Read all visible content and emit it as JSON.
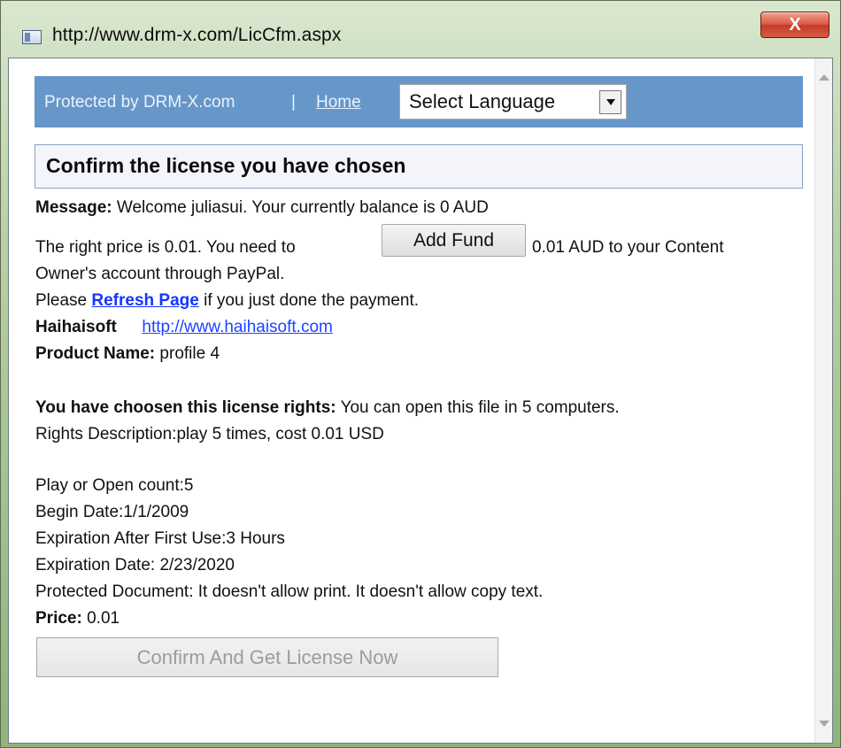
{
  "window": {
    "title": "http://www.drm-x.com/LicCfm.aspx",
    "close_label": "X"
  },
  "header": {
    "protected_by": "Protected by DRM-X.com",
    "separator": "|",
    "home_label": "Home",
    "language_select_value": "Select Language"
  },
  "section": {
    "title": "Confirm the license you have chosen"
  },
  "content": {
    "message_label": "Message:",
    "message_text": "Welcome juliasui. Your currently balance is 0 AUD",
    "price_line_prefix": "The right price is 0.01. You need to",
    "add_fund_label": "Add Fund",
    "price_line_suffix": "0.01 AUD to your Content",
    "owner_line": "Owner's account through PayPal.",
    "refresh_prefix": "Please",
    "refresh_link": "Refresh Page",
    "refresh_suffix": "if you just done the payment.",
    "company_name": "Haihaisoft",
    "company_link": "http://www.haihaisoft.com",
    "product_label": "Product Name:",
    "product_value": "profile 4",
    "rights_label": "You have choosen this license rights:",
    "rights_value": "You can open this file in 5 computers.",
    "rights_description": "Rights Description:play 5 times, cost 0.01 USD",
    "play_count": "Play or Open count:5",
    "begin_date": "Begin Date:1/1/2009",
    "expiration_after_first_use": "Expiration After First Use:3 Hours",
    "expiration_date": "Expiration Date: 2/23/2020",
    "protected_document": "Protected Document: It doesn't allow print. It doesn't allow copy text.",
    "price_label": "Price:",
    "price_value": "0.01",
    "confirm_button": "Confirm And Get License Now"
  },
  "colors": {
    "header_bar": "#6797c9",
    "link": "#1d43ff",
    "section_border": "#8aa1c3",
    "close_button": "#c63b28"
  }
}
